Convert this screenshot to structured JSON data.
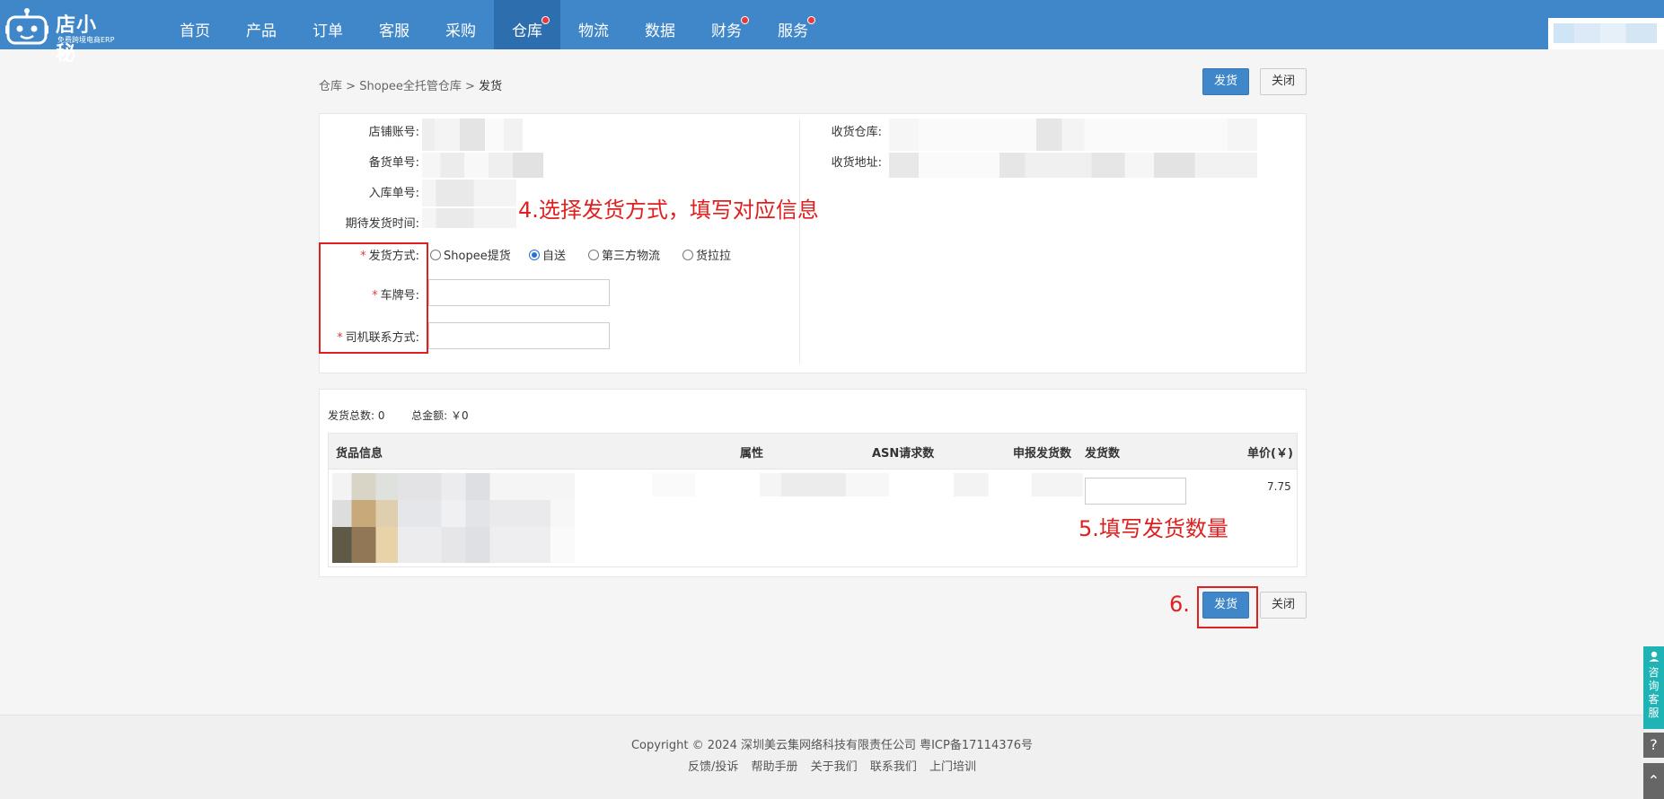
{
  "app": {
    "logo_text": "店小秘",
    "logo_sub": "免费跨境电商ERP"
  },
  "nav": {
    "items": [
      {
        "label": "首页",
        "dot": false
      },
      {
        "label": "产品",
        "dot": false
      },
      {
        "label": "订单",
        "dot": false
      },
      {
        "label": "客服",
        "dot": false
      },
      {
        "label": "采购",
        "dot": false
      },
      {
        "label": "仓库",
        "dot": true,
        "active": true
      },
      {
        "label": "物流",
        "dot": false
      },
      {
        "label": "数据",
        "dot": false
      },
      {
        "label": "财务",
        "dot": true
      },
      {
        "label": "服务",
        "dot": true
      }
    ]
  },
  "breadcrumb": {
    "level1": "仓库",
    "sep": ">",
    "level2": "Shopee全托管仓库",
    "current": "发货"
  },
  "actions": {
    "ship_label": "发货",
    "close_label": "关闭"
  },
  "info": {
    "shop_account_label": "店铺账号:",
    "stock_order_label": "备货单号:",
    "inbound_order_label": "入库单号:",
    "expected_ship_time_label": "期待发货时间:",
    "receive_warehouse_label": "收货仓库:",
    "receive_address_label": "收货地址:"
  },
  "form": {
    "ship_method_label": "发货方式:",
    "ship_methods": [
      "Shopee提货",
      "自送",
      "第三方物流",
      "货拉拉"
    ],
    "selected_method": "自送",
    "plate_label": "车牌号:",
    "driver_contact_label": "司机联系方式:",
    "required_mark": "*"
  },
  "annotations": {
    "step4": "4.选择发货方式，填写对应信息",
    "step5": "5.填写发货数量",
    "step6": "6."
  },
  "summary": {
    "total_qty_label": "发货总数:",
    "total_qty": "0",
    "total_amount_label": "总金额:",
    "total_amount": "￥0"
  },
  "table": {
    "headers": {
      "goods": "货品信息",
      "attr": "属性",
      "asn": "ASN请求数",
      "declared": "申报发货数",
      "ship_qty": "发货数",
      "unit_price": "单价(￥)"
    },
    "rows": [
      {
        "unit_price": "7.75",
        "ship_qty": ""
      }
    ]
  },
  "footer": {
    "copyright": "Copyright © 2024 深圳美云集网络科技有限责任公司  粤ICP备17114376号",
    "links": [
      "反馈/投诉",
      "帮助手册",
      "关于我们",
      "联系我们",
      "上门培训"
    ]
  },
  "side": {
    "consult_label": "咨询客服",
    "help_icon": "question-icon",
    "top_icon": "arrow-up-icon"
  }
}
